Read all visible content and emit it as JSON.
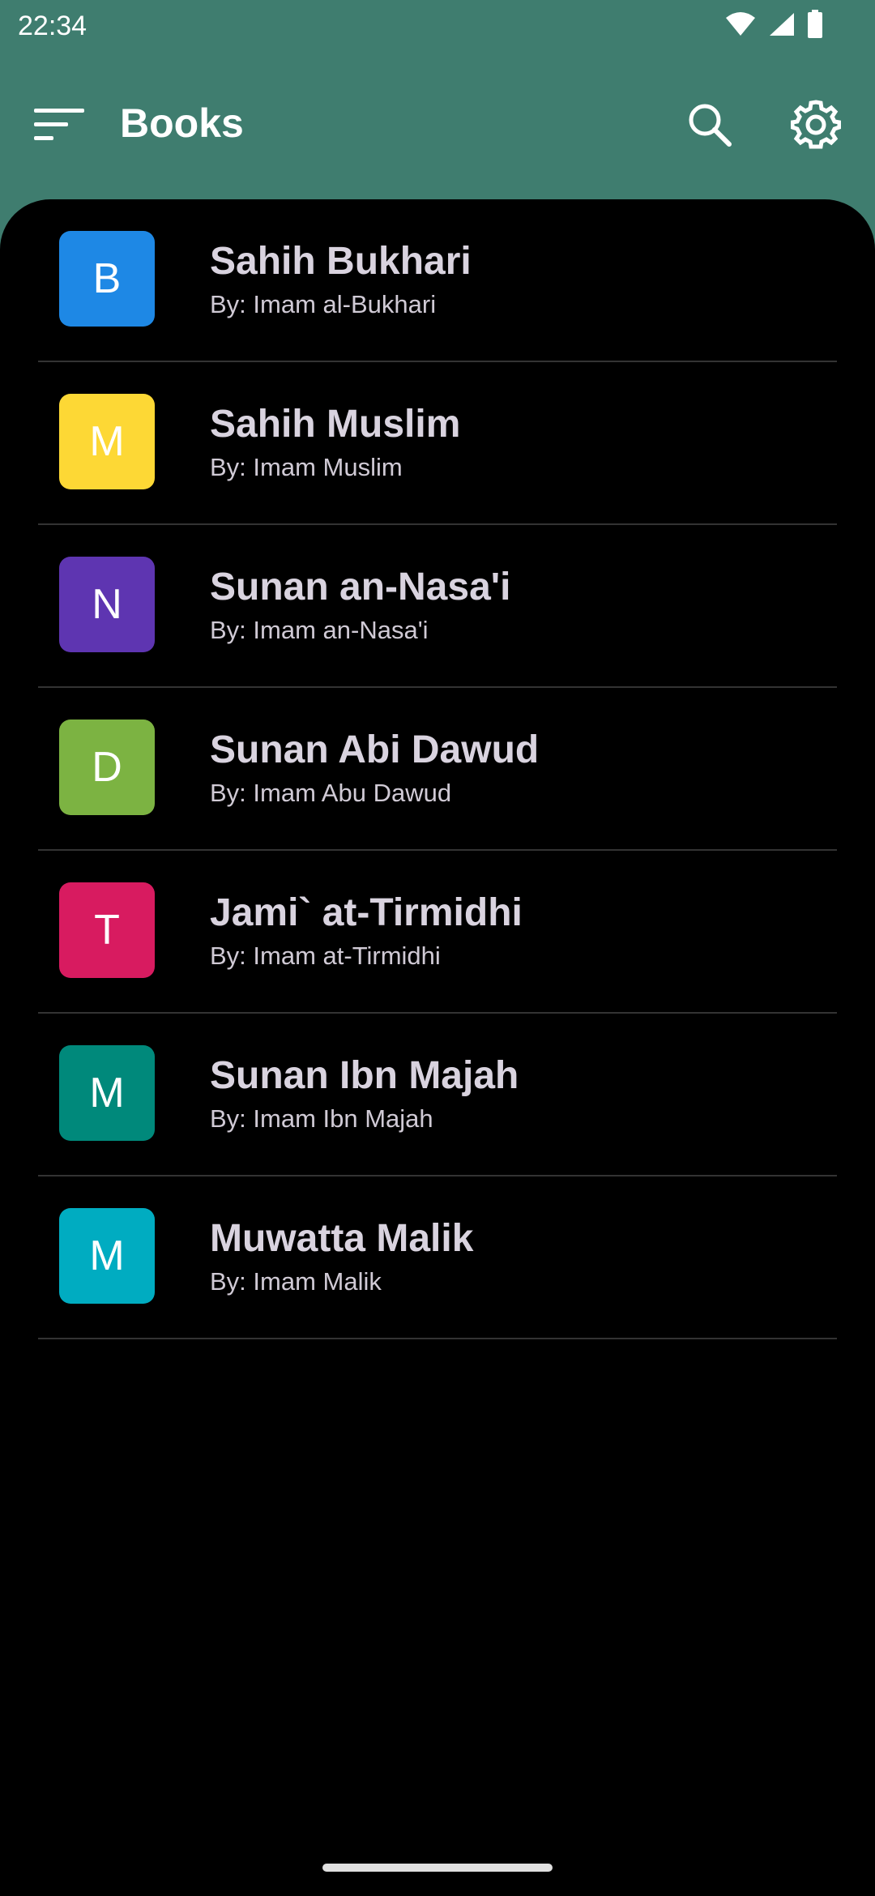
{
  "status_bar": {
    "time": "22:34",
    "icons": [
      "wifi-icon",
      "signal-icon",
      "battery-icon"
    ]
  },
  "app_bar": {
    "title": "Books",
    "menu_icon": "sort-lines-icon",
    "search_icon": "search-icon",
    "settings_icon": "gear-icon",
    "color": "#3f7d6f"
  },
  "books": [
    {
      "letter": "B",
      "title": "Sahih Bukhari",
      "author": "By: Imam al-Bukhari",
      "color": "#1e88e5"
    },
    {
      "letter": "M",
      "title": "Sahih Muslim",
      "author": "By: Imam Muslim",
      "color": "#fdd835"
    },
    {
      "letter": "N",
      "title": "Sunan an-Nasa'i",
      "author": "By: Imam an-Nasa'i",
      "color": "#5e35b1"
    },
    {
      "letter": "D",
      "title": "Sunan Abi Dawud",
      "author": "By: Imam Abu Dawud",
      "color": "#7cb342"
    },
    {
      "letter": "T",
      "title": "Jami` at-Tirmidhi",
      "author": "By: Imam at-Tirmidhi",
      "color": "#d81b60"
    },
    {
      "letter": "M",
      "title": "Sunan Ibn Majah",
      "author": "By: Imam Ibn Majah",
      "color": "#00897b"
    },
    {
      "letter": "M",
      "title": "Muwatta Malik",
      "author": "By: Imam Malik",
      "color": "#00acc1"
    }
  ]
}
